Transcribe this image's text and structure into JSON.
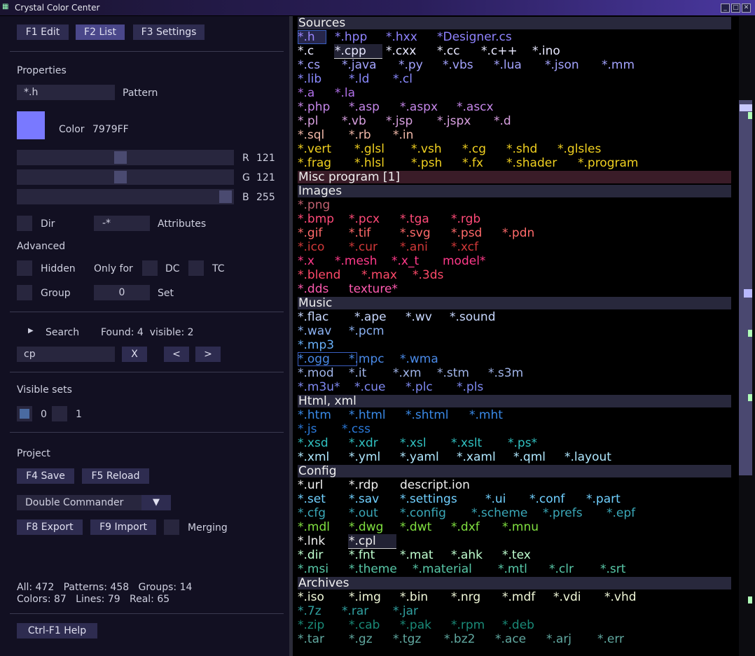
{
  "window": {
    "title": "Crystal Color Center",
    "min": "_",
    "max": "□",
    "close": "✕"
  },
  "left": {
    "tabs": [
      "F1 Edit",
      "F2 List",
      "F3 Settings"
    ],
    "properties_header": "Properties",
    "pattern_value": "*.h",
    "pattern_label": "Pattern",
    "color_label": "Color",
    "color_hex": "7979FF",
    "swatch_color": "#7979FF",
    "r_label": "R",
    "r_value": "121",
    "g_label": "G",
    "g_value": "121",
    "b_label": "B",
    "b_value": "255",
    "dir_label": "Dir",
    "attr_value": "-*",
    "attr_label": "Attributes",
    "advanced_header": "Advanced",
    "hidden_label": "Hidden",
    "only_for_label": "Only for",
    "dc_label": "DC",
    "tc_label": "TC",
    "group_label": "Group",
    "set_value": "0",
    "set_label": "Set",
    "search_label": "Search",
    "search_arrow": "▶",
    "found_text": "Found: 4  visible: 2",
    "search_value": "cp",
    "clear_btn": "X",
    "prev_btn": "<",
    "next_btn": ">",
    "visible_sets_header": "Visible sets",
    "set0_label": "0",
    "set1_label": "1",
    "project_header": "Project",
    "save_btn": "F4 Save",
    "reload_btn": "F5 Reload",
    "commander_value": "Double Commander",
    "dropdown_arrow": "▼",
    "export_btn": "F8 Export",
    "import_btn": "F9 Import",
    "merging_label": "Merging",
    "stats_line1": "All: 472   Patterns: 458   Groups: 14",
    "stats_line2": "Colors: 87   Lines: 79   Real: 65",
    "help_btn": "Ctrl-F1  Help"
  },
  "list": [
    {
      "section": "Sources"
    },
    {
      "tokens": [
        [
          "*.h",
          "#9a86ff"
        ],
        [
          "*.hpp",
          "#8f83ff"
        ],
        [
          "*.hxx",
          "#8f83ff"
        ],
        [
          "*Designer.cs",
          "#8f83ff"
        ]
      ]
    },
    {
      "tokens": [
        [
          "*.c",
          "#e8e8ff"
        ],
        [
          "*.cpp",
          "#e8e8ff"
        ],
        [
          "*.cxx",
          "#e8e8ff"
        ],
        [
          "*.cc",
          "#e8e8ff"
        ],
        [
          "*.c++",
          "#e8e8ff"
        ],
        [
          "*.ino",
          "#e8e8ff"
        ]
      ]
    },
    {
      "tokens": [
        [
          "*.cs",
          "#a4a4ff"
        ],
        [
          "*.java",
          "#a4a4ff"
        ],
        [
          "*.py",
          "#a4a4ff"
        ],
        [
          "*.vbs",
          "#a4a4ff"
        ],
        [
          "*.lua",
          "#a4a4ff"
        ],
        [
          "*.json",
          "#a4a4ff"
        ],
        [
          "*.mm",
          "#a4a4ff"
        ]
      ]
    },
    {
      "tokens": [
        [
          "*.lib",
          "#8a8aff"
        ],
        [
          "*.ld",
          "#8a8aff"
        ],
        [
          "*.cl",
          "#8a8aff"
        ]
      ]
    },
    {
      "tokens": [
        [
          "*.a",
          "#b070e8"
        ],
        [
          "*.la",
          "#b070e8"
        ]
      ]
    },
    {
      "tokens": [
        [
          "*.php",
          "#c486e8"
        ],
        [
          "*.asp",
          "#c486e8"
        ],
        [
          "*.aspx",
          "#c486e8"
        ],
        [
          "*.ascx",
          "#c486e8"
        ]
      ]
    },
    {
      "tokens": [
        [
          "*.pl",
          "#d8a0e0"
        ],
        [
          "*.vb",
          "#d8a0e0"
        ],
        [
          "*.jsp",
          "#d8a0e0"
        ],
        [
          "*.jspx",
          "#d8a0e0"
        ],
        [
          "*.d",
          "#d8a0e0"
        ]
      ]
    },
    {
      "tokens": [
        [
          "*.sql",
          "#f0b8a8"
        ],
        [
          "*.rb",
          "#f0b8a8"
        ],
        [
          "*.in",
          "#f0b8a8"
        ]
      ]
    },
    {
      "tokens": [
        [
          "*.vert",
          "#f0d020"
        ],
        [
          "*.glsl",
          "#f0d020"
        ],
        [
          "*.vsh",
          "#f0d020"
        ],
        [
          "*.cg",
          "#f0d020"
        ],
        [
          "*.shd",
          "#f0d020"
        ],
        [
          "*.glsles",
          "#f0d020"
        ]
      ]
    },
    {
      "tokens": [
        [
          "*.frag",
          "#f0d020"
        ],
        [
          "*.hlsl",
          "#f0d020"
        ],
        [
          "*.psh",
          "#f0d020"
        ],
        [
          "*.fx",
          "#f0d020"
        ],
        [
          "*.shader",
          "#f0d020"
        ],
        [
          "*.program",
          "#f0d020"
        ]
      ]
    },
    {
      "section": "Misc program  [1]",
      "misc": true
    },
    {
      "section": "Images"
    },
    {
      "tokens": [
        [
          "*.png",
          "#c06070"
        ]
      ]
    },
    {
      "tokens": [
        [
          "*.bmp",
          "#ff4a78"
        ],
        [
          "*.pcx",
          "#ff4a78"
        ],
        [
          "*.tga",
          "#ff4a78"
        ],
        [
          "*.rgb",
          "#ff4a78"
        ]
      ]
    },
    {
      "tokens": [
        [
          "*.gif",
          "#ff6a6a"
        ],
        [
          "*.tif",
          "#ff6a6a"
        ],
        [
          "*.svg",
          "#ff6a6a"
        ],
        [
          "*.psd",
          "#ff6a6a"
        ],
        [
          "*.pdn",
          "#ff6a6a"
        ]
      ]
    },
    {
      "tokens": [
        [
          "*.ico",
          "#d03838"
        ],
        [
          "*.cur",
          "#d03838"
        ],
        [
          "*.ani",
          "#d03838"
        ],
        [
          "*.xcf",
          "#d03838"
        ]
      ]
    },
    {
      "tokens": [
        [
          "*.x",
          "#ff3a8a"
        ],
        [
          "*.mesh",
          "#ff3a8a"
        ],
        [
          "*.x_t",
          "#ff3a8a"
        ],
        [
          "model*",
          "#ff3a8a"
        ]
      ]
    },
    {
      "tokens": [
        [
          "*.blend",
          "#ff4a6a"
        ],
        [
          "*.max",
          "#ff4a6a"
        ],
        [
          "*.3ds",
          "#ff4a6a"
        ]
      ]
    },
    {
      "tokens": [
        [
          "*.dds",
          "#ff5ab0"
        ],
        [
          "texture*",
          "#ff5ab0"
        ]
      ]
    },
    {
      "section": "Music"
    },
    {
      "tokens": [
        [
          "*.flac",
          "#c8d8ff"
        ],
        [
          "*.ape",
          "#c8d8ff"
        ],
        [
          "*.wv",
          "#c8d8ff"
        ],
        [
          "*.sound",
          "#c8d8ff"
        ]
      ]
    },
    {
      "tokens": [
        [
          "*.wav",
          "#8ab0f0"
        ],
        [
          "*.pcm",
          "#8ab0f0"
        ]
      ]
    },
    {
      "tokens": [
        [
          "*.mp3",
          "#68b0f8"
        ]
      ]
    },
    {
      "tokens": [
        [
          "*.ogg",
          "#4a8ae8"
        ],
        [
          "*.mpc",
          "#4a8ae8"
        ],
        [
          "*.wma",
          "#4a8ae8"
        ]
      ]
    },
    {
      "tokens": [
        [
          "*.mod",
          "#a0b4e8"
        ],
        [
          "*.it",
          "#a0b4e8"
        ],
        [
          "*.xm",
          "#a0b4e8"
        ],
        [
          "*.stm",
          "#a0b4e8"
        ],
        [
          "*.s3m",
          "#a0b4e8"
        ]
      ]
    },
    {
      "tokens": [
        [
          "*.m3u*",
          "#7e88f0"
        ],
        [
          "*.cue",
          "#7e88f0"
        ],
        [
          "*.plc",
          "#7e88f0"
        ],
        [
          "*.pls",
          "#7e88f0"
        ]
      ]
    },
    {
      "section": "Html, xml"
    },
    {
      "tokens": [
        [
          "*.htm",
          "#3a8ae8"
        ],
        [
          "*.html",
          "#3a8ae8"
        ],
        [
          "*.shtml",
          "#3a8ae8"
        ],
        [
          "*.mht",
          "#3a8ae8"
        ]
      ]
    },
    {
      "tokens": [
        [
          "*.js",
          "#2a78d8"
        ],
        [
          "*.css",
          "#2a78d8"
        ]
      ]
    },
    {
      "tokens": [
        [
          "*.xsd",
          "#30c0c0"
        ],
        [
          "*.xdr",
          "#30c0c0"
        ],
        [
          "*.xsl",
          "#30c0c0"
        ],
        [
          "*.xslt",
          "#30c0c0"
        ],
        [
          "*.ps*",
          "#30c0c0"
        ]
      ]
    },
    {
      "tokens": [
        [
          "*.xml",
          "#b0e8ff"
        ],
        [
          "*.yml",
          "#b0e8ff"
        ],
        [
          "*.yaml",
          "#b0e8ff"
        ],
        [
          "*.xaml",
          "#b0e8ff"
        ],
        [
          "*.qml",
          "#b0e8ff"
        ],
        [
          "*.layout",
          "#b0e8ff"
        ]
      ]
    },
    {
      "section": "Config"
    },
    {
      "tokens": [
        [
          "*.url",
          "#f0f0f0"
        ],
        [
          "*.rdp",
          "#f0f0f0"
        ],
        [
          "descript.ion",
          "#f0f0f0"
        ]
      ]
    },
    {
      "tokens": [
        [
          "*.set",
          "#70d0ff"
        ],
        [
          "*.sav",
          "#70d0ff"
        ],
        [
          "*.settings",
          "#70d0ff"
        ],
        [
          "*.ui",
          "#70d0ff"
        ],
        [
          "*.conf",
          "#70d0ff"
        ],
        [
          "*.part",
          "#70d0ff"
        ]
      ]
    },
    {
      "tokens": [
        [
          "*.cfg",
          "#3aa8b8"
        ],
        [
          "*.out",
          "#3aa8b8"
        ],
        [
          "*.config",
          "#3aa8b8"
        ],
        [
          "*.scheme",
          "#3aa8b8"
        ],
        [
          "*.prefs",
          "#3aa8b8"
        ],
        [
          "*.epf",
          "#3aa8b8"
        ]
      ]
    },
    {
      "tokens": [
        [
          "*.mdl",
          "#80e040"
        ],
        [
          "*.dwg",
          "#80e040"
        ],
        [
          "*.dwt",
          "#80e040"
        ],
        [
          "*.dxf",
          "#80e040"
        ],
        [
          "*.mnu",
          "#80e040"
        ]
      ]
    },
    {
      "tokens": [
        [
          "*.lnk",
          "#f0f0f0"
        ],
        [
          "*.cpl",
          "#f0f0f0"
        ]
      ]
    },
    {
      "tokens": [
        [
          "*.dir",
          "#c0ffd0"
        ],
        [
          "*.fnt",
          "#c0ffd0"
        ],
        [
          "*.mat",
          "#c0ffd0"
        ],
        [
          "*.ahk",
          "#c0ffd0"
        ],
        [
          "*.tex",
          "#c0ffd0"
        ]
      ]
    },
    {
      "tokens": [
        [
          "*.msi",
          "#58c8a8"
        ],
        [
          "*.theme",
          "#58c8a8"
        ],
        [
          "*.material",
          "#58c8a8"
        ],
        [
          "*.mtl",
          "#58c8a8"
        ],
        [
          "*.clr",
          "#58c8a8"
        ],
        [
          "*.srt",
          "#58c8a8"
        ]
      ]
    },
    {
      "section": "Archives"
    },
    {
      "tokens": [
        [
          "*.iso",
          "#f0f8d8"
        ],
        [
          "*.img",
          "#f0f8d8"
        ],
        [
          "*.bin",
          "#f0f8d8"
        ],
        [
          "*.nrg",
          "#f0f8d8"
        ],
        [
          "*.mdf",
          "#f0f8d8"
        ],
        [
          "*.vdi",
          "#f0f8d8"
        ],
        [
          "*.vhd",
          "#f0f8d8"
        ]
      ]
    },
    {
      "tokens": [
        [
          "*.7z",
          "#30a0a0"
        ],
        [
          "*.rar",
          "#30a0a0"
        ],
        [
          "*.jar",
          "#30a0a0"
        ]
      ]
    },
    {
      "tokens": [
        [
          "*.zip",
          "#1a8a78"
        ],
        [
          "*.cab",
          "#1a8a78"
        ],
        [
          "*.pak",
          "#1a8a78"
        ],
        [
          "*.rpm",
          "#1a8a78"
        ],
        [
          "*.deb",
          "#1a8a78"
        ]
      ]
    },
    {
      "tokens": [
        [
          "*.tar",
          "#60a8a0"
        ],
        [
          "*.gz",
          "#60a8a0"
        ],
        [
          "*.tgz",
          "#60a8a0"
        ],
        [
          "*.bz2",
          "#60a8a0"
        ],
        [
          "*.ace",
          "#60a8a0"
        ],
        [
          "*.arj",
          "#60a8a0"
        ],
        [
          "*.err",
          "#60a8a0"
        ]
      ]
    }
  ]
}
